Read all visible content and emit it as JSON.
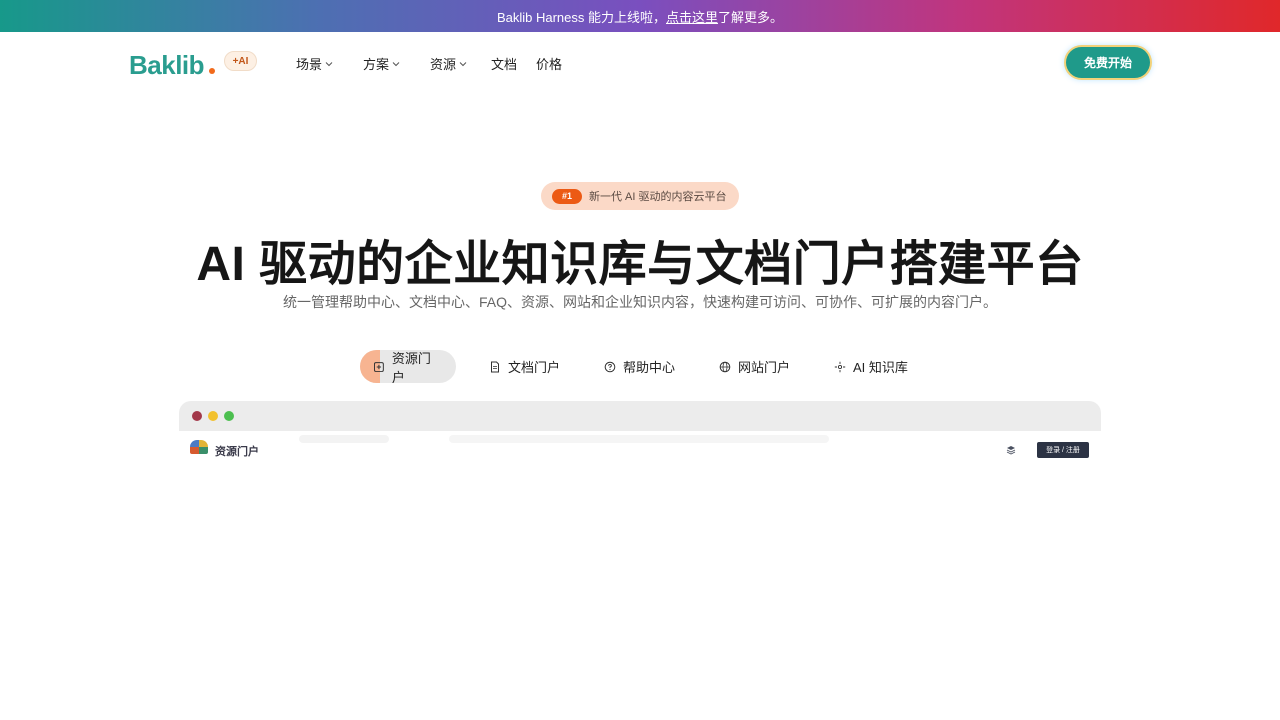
{
  "announcement": {
    "text_before": "Baklib Harness 能力上线啦，",
    "link": "点击这里",
    "text_after": "了解更多。"
  },
  "nav": {
    "logo": "Baklib",
    "ai_badge": "+AI",
    "items": [
      {
        "label": "场景",
        "has_dropdown": true
      },
      {
        "label": "方案",
        "has_dropdown": true
      },
      {
        "label": "资源",
        "has_dropdown": true
      },
      {
        "label": "文档",
        "has_dropdown": false
      },
      {
        "label": "价格",
        "has_dropdown": false
      }
    ],
    "cta": "免费开始"
  },
  "hero": {
    "badge_number": "#1",
    "badge_text": "新一代 AI 驱动的内容云平台",
    "title": "AI 驱动的企业知识库与文档门户搭建平台",
    "subtitle": "统一管理帮助中心、文档中心、FAQ、资源、网站和企业知识内容，快速构建可访问、可协作、可扩展的内容门户。"
  },
  "tabs": [
    {
      "label": "资源门户",
      "icon": "plus-square-icon",
      "active": true
    },
    {
      "label": "文档门户",
      "icon": "document-icon",
      "active": false
    },
    {
      "label": "帮助中心",
      "icon": "question-circle-icon",
      "active": false
    },
    {
      "label": "网站门户",
      "icon": "globe-icon",
      "active": false
    },
    {
      "label": "AI 知识库",
      "icon": "sparkle-icon",
      "active": false
    }
  ],
  "preview": {
    "site_name": "资源门户",
    "login_button": "登录 / 注册",
    "window_dots": [
      "#a3384a",
      "#f2c12e",
      "#4cbf4f"
    ]
  },
  "colors": {
    "brand": "#2a9d8f",
    "accent": "#ec5a14",
    "cta": "#1f9a8a"
  }
}
